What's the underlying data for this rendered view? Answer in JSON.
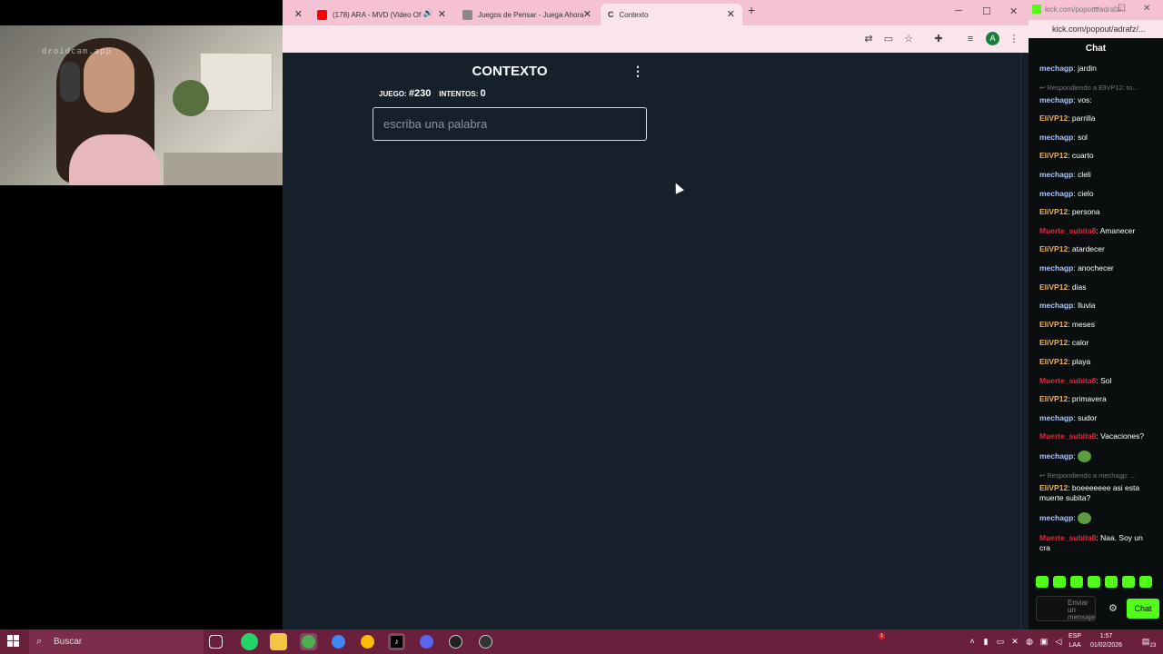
{
  "webcam": {
    "watermark": "droidcam.app"
  },
  "browser": {
    "tabs": [
      {
        "label": "(178) ARA - MVD (Video Of",
        "favicon_color": "#ff0000",
        "icon": "youtube-icon"
      },
      {
        "label": "Juegos de Pensar - Juega Ahora",
        "favicon_color": "#666666",
        "icon": "game-icon"
      },
      {
        "label": "Contexto",
        "favicon_color": "#333333",
        "icon": "contexto-icon",
        "active": true
      }
    ],
    "new_tab": "+",
    "profile_initial": "A"
  },
  "page": {
    "title": "CONTEXTO",
    "game_label": "JUEGO:",
    "game_number": "#230",
    "attempts_label": "INTENTOS:",
    "attempts_value": "0",
    "input_placeholder": "escriba una palabra"
  },
  "chat": {
    "url": "kick.com/popout/adrafz/...",
    "header": "Chat",
    "messages": [
      {
        "user": "mechagp",
        "color": "#a6c7ff",
        "text": "jardin"
      },
      {
        "reply": "Respondiendo a EliVP12: to..."
      },
      {
        "user": "mechagp",
        "color": "#a6c7ff",
        "text": "vos:"
      },
      {
        "user": "EliVP12",
        "color": "#f0b35a",
        "text": "parrilla"
      },
      {
        "user": "mechagp",
        "color": "#a6c7ff",
        "text": "sol"
      },
      {
        "user": "EliVP12",
        "color": "#f0b35a",
        "text": "cuarto"
      },
      {
        "user": "mechagp",
        "color": "#a6c7ff",
        "text": "cleli"
      },
      {
        "user": "mechagp",
        "color": "#a6c7ff",
        "text": "cielo"
      },
      {
        "user": "EliVP12",
        "color": "#f0b35a",
        "text": "persona"
      },
      {
        "user": "Muerte_subita8",
        "color": "#e0283c",
        "text": "Amanecer"
      },
      {
        "user": "EliVP12",
        "color": "#f0b35a",
        "text": "atardecer"
      },
      {
        "user": "mechagp",
        "color": "#a6c7ff",
        "text": "anochecer"
      },
      {
        "user": "EliVP12",
        "color": "#f0b35a",
        "text": "dias"
      },
      {
        "user": "mechagp",
        "color": "#a6c7ff",
        "text": "lluvia"
      },
      {
        "user": "EliVP12",
        "color": "#f0b35a",
        "text": "meses"
      },
      {
        "user": "EliVP12",
        "color": "#f0b35a",
        "text": "calor"
      },
      {
        "user": "EliVP12",
        "color": "#f0b35a",
        "text": "playa"
      },
      {
        "user": "Muerte_subita8",
        "color": "#e0283c",
        "text": "Sol"
      },
      {
        "user": "EliVP12",
        "color": "#f0b35a",
        "text": "primavera"
      },
      {
        "user": "mechagp",
        "color": "#a6c7ff",
        "text": "sudor"
      },
      {
        "user": "Muerte_subita8",
        "color": "#e0283c",
        "text": "Vacaciones?"
      },
      {
        "user": "mechagp",
        "color": "#a6c7ff",
        "text": "",
        "emote": true
      },
      {
        "reply": "Respondiendo a mechagp: ..."
      },
      {
        "user": "EliVP12",
        "color": "#f0b35a",
        "text": "boeeeeeee asi esta muerte subita?"
      },
      {
        "user": "mechagp",
        "color": "#a6c7ff",
        "text": "",
        "emote": true
      },
      {
        "user": "Muerte_subita8",
        "color": "#e0283c",
        "text": "Naa. Soy un cra"
      }
    ],
    "input_placeholder": "Enviar un mensaje",
    "send_label": "Chat"
  },
  "taskbar": {
    "search_placeholder": "Buscar",
    "lang_line1": "ESP",
    "lang_line2": "LAA",
    "time": "1:57",
    "date": "01/02/2026",
    "notif_count": "23",
    "badge": "1"
  }
}
